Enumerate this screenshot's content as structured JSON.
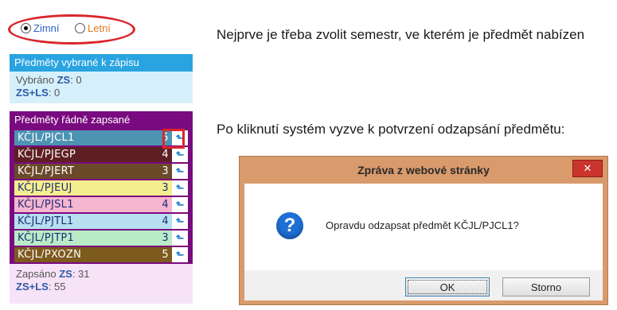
{
  "semester": {
    "options": [
      {
        "label": "Zimní",
        "checked": true,
        "color": "#2f62c9"
      },
      {
        "label": "Letní",
        "checked": false,
        "color": "#e07a1f"
      }
    ]
  },
  "selected_panel": {
    "title": "Předměty vybrané k zápisu",
    "line1_prefix": "Vybráno ",
    "line1_key": "ZS",
    "line1_value": ": 0",
    "line2_key": "ZS+LS",
    "line2_value": ": 0"
  },
  "enrolled_panel": {
    "title": "Předměty řádně zapsané",
    "arrow_glyph": "⬑",
    "rows": [
      {
        "code": "KČJL/PJCL1",
        "credits": "5",
        "bg": "#4d94b3",
        "text": "dark"
      },
      {
        "code": "KČJL/PJEGP",
        "credits": "4",
        "bg": "#5e1f22",
        "text": "dark"
      },
      {
        "code": "KČJL/PJERT",
        "credits": "3",
        "bg": "#6b4a2a",
        "text": "dark"
      },
      {
        "code": "KČJL/PJEUJ",
        "credits": "3",
        "bg": "#f5ee8e",
        "text": "light"
      },
      {
        "code": "KČJL/PJSL1",
        "credits": "4",
        "bg": "#f6b6cf",
        "text": "light"
      },
      {
        "code": "KČJL/PJTL1",
        "credits": "4",
        "bg": "#b8dff0",
        "text": "light"
      },
      {
        "code": "KČJL/PJTP1",
        "credits": "3",
        "bg": "#b9ecc6",
        "text": "light"
      },
      {
        "code": "KČJL/PXOZN",
        "credits": "5",
        "bg": "#7d5a1e",
        "text": "dark"
      }
    ],
    "line1_prefix": "Zapsáno ",
    "line1_key": "ZS",
    "line1_value": ": 31",
    "line2_key": "ZS+LS",
    "line2_value": ": 55"
  },
  "notes": {
    "first": "Nejprve je třeba zvolit semestr, ve kterém je předmět nabízen",
    "second": "Po kliknutí systém vyzve k potvrzení odzapsání předmětu:"
  },
  "dialog": {
    "title": "Zpráva z webové stránky",
    "close_glyph": "✕",
    "icon_glyph": "?",
    "message": "Opravdu odzapsat předmět KČJL/PJCL1?",
    "ok_label": "OK",
    "cancel_label": "Storno"
  },
  "colors": {
    "accent_red": "#d9262c",
    "selected_header": "#29a4e0",
    "enrolled_bg": "#7a0a7f",
    "dialog_frame": "#d99a6c"
  }
}
